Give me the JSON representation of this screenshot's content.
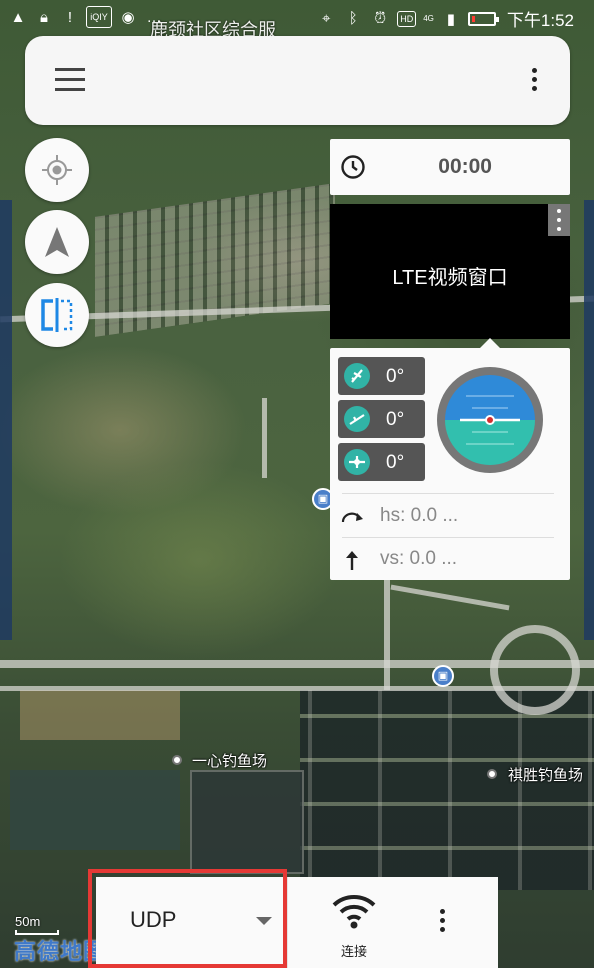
{
  "status_bar": {
    "time": "下午1:52",
    "battery_level": 0.15,
    "signal_box": "HD",
    "network": "4G"
  },
  "map": {
    "title": "鹿颈社区综合服",
    "pois": [
      "一心钓鱼场",
      "祺胜钓鱼场"
    ],
    "scale": "50m",
    "logo": "高德地图"
  },
  "app_bar": {
    "menu_icon": "hamburger-menu-icon",
    "overflow_icon": "more-vert-icon"
  },
  "map_buttons": [
    {
      "name": "locate-button",
      "icon": "crosshair-icon"
    },
    {
      "name": "navigation-button",
      "icon": "navigation-arrow-icon"
    },
    {
      "name": "split-view-button",
      "icon": "split-panel-icon"
    }
  ],
  "timer": {
    "value": "00:00",
    "icon": "clock-icon"
  },
  "video": {
    "label": "LTE视频窗口"
  },
  "attitude": {
    "roll": "0°",
    "pitch": "0°",
    "yaw": "0°",
    "hs": "hs: 0.0 ...",
    "vs": "vs: 0.0 ..."
  },
  "bottom_bar": {
    "protocol": "UDP",
    "connect_label": "连接",
    "colors": {
      "highlight": "#e53935",
      "accent": "#31b3a6"
    }
  }
}
